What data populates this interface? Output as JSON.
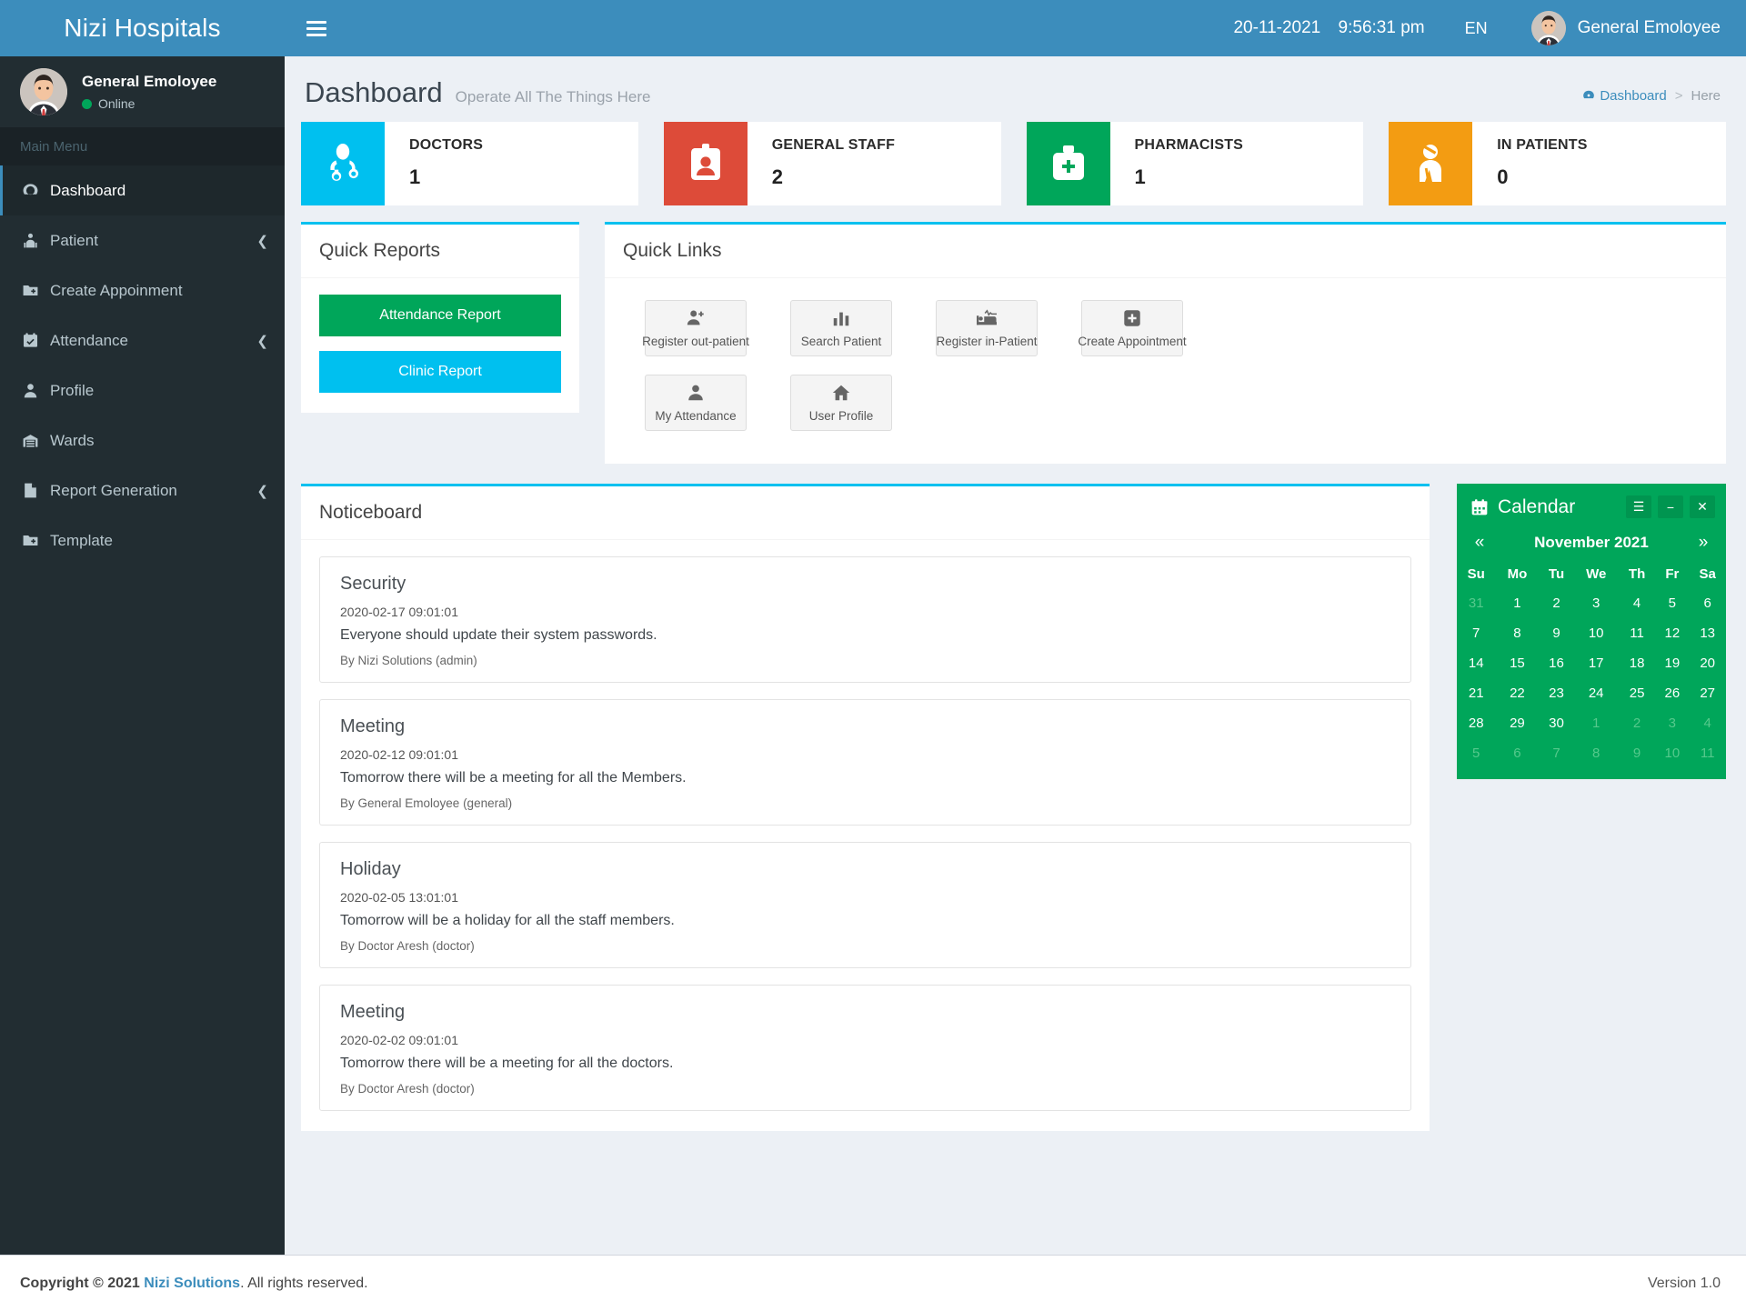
{
  "brand": {
    "title": "Nizi Hospitals"
  },
  "navbar": {
    "date": "20-11-2021",
    "time": "9:56:31 pm",
    "lang": "EN",
    "user": "General Emoloyee"
  },
  "sidebar": {
    "user": {
      "name": "General Emoloyee",
      "status": "Online"
    },
    "section_label": "Main Menu",
    "items": [
      {
        "label": "Dashboard",
        "icon": "dashboard-icon",
        "active": true,
        "caret": false
      },
      {
        "label": "Patient",
        "icon": "patient-icon",
        "active": false,
        "caret": true
      },
      {
        "label": "Create Appoinment",
        "icon": "folder-plus-icon",
        "active": false,
        "caret": false
      },
      {
        "label": "Attendance",
        "icon": "calendar-check-icon",
        "active": false,
        "caret": true
      },
      {
        "label": "Profile",
        "icon": "user-icon",
        "active": false,
        "caret": false
      },
      {
        "label": "Wards",
        "icon": "warehouse-icon",
        "active": false,
        "caret": false
      },
      {
        "label": "Report Generation",
        "icon": "file-icon",
        "active": false,
        "caret": true
      },
      {
        "label": "Template",
        "icon": "folder-plus-icon",
        "active": false,
        "caret": false
      }
    ]
  },
  "page": {
    "title": "Dashboard",
    "subtitle": "Operate All The Things Here",
    "breadcrumb": {
      "root": "Dashboard",
      "separator": ">",
      "current": "Here"
    }
  },
  "stats": [
    {
      "label": "DOCTORS",
      "value": "1",
      "color": "#00c0ef",
      "icon": "doctor-icon"
    },
    {
      "label": "GENERAL STAFF",
      "value": "2",
      "color": "#dd4b39",
      "icon": "id-badge-icon"
    },
    {
      "label": "PHARMACISTS",
      "value": "1",
      "color": "#00a65a",
      "icon": "medkit-icon"
    },
    {
      "label": "IN PATIENTS",
      "value": "0",
      "color": "#f39c12",
      "icon": "injured-icon"
    }
  ],
  "quick_reports": {
    "title": "Quick Reports",
    "buttons": [
      {
        "label": "Attendance Report",
        "color": "#00a65a"
      },
      {
        "label": "Clinic Report",
        "color": "#00c0ef"
      }
    ]
  },
  "quick_links": {
    "title": "Quick Links",
    "items": [
      {
        "label": "Register out-patient",
        "icon": "user-plus-icon"
      },
      {
        "label": "Search Patient",
        "icon": "chart-bar-icon"
      },
      {
        "label": "Register in-Patient",
        "icon": "bed-monitor-icon"
      },
      {
        "label": "Create Appointment",
        "icon": "plus-square-icon"
      },
      {
        "label": "My Attendance",
        "icon": "user-icon"
      },
      {
        "label": "User Profile",
        "icon": "home-icon"
      }
    ]
  },
  "noticeboard": {
    "title": "Noticeboard",
    "notices": [
      {
        "title": "Security",
        "date": "2020-02-17 09:01:01",
        "body": "Everyone should update their system passwords.",
        "author": "By Nizi Solutions (admin)"
      },
      {
        "title": "Meeting",
        "date": "2020-02-12 09:01:01",
        "body": "Tomorrow there will be a meeting for all the Members.",
        "author": "By General Emoloyee (general)"
      },
      {
        "title": "Holiday",
        "date": "2020-02-05 13:01:01",
        "body": "Tomorrow will be a holiday for all the staff members.",
        "author": "By Doctor Aresh (doctor)"
      },
      {
        "title": "Meeting",
        "date": "2020-02-02 09:01:01",
        "body": "Tomorrow there will be a meeting for all the doctors.",
        "author": "By Doctor Aresh (doctor)"
      }
    ]
  },
  "calendar": {
    "title": "Calendar",
    "month_label": "November 2021",
    "prev": "«",
    "next": "»",
    "tools": {
      "menu": "☰",
      "minimize": "−",
      "close": "✕"
    },
    "weekdays": [
      "Su",
      "Mo",
      "Tu",
      "We",
      "Th",
      "Fr",
      "Sa"
    ],
    "weeks": [
      [
        {
          "d": "31",
          "mute": true
        },
        {
          "d": "1"
        },
        {
          "d": "2"
        },
        {
          "d": "3"
        },
        {
          "d": "4"
        },
        {
          "d": "5"
        },
        {
          "d": "6"
        }
      ],
      [
        {
          "d": "7"
        },
        {
          "d": "8"
        },
        {
          "d": "9"
        },
        {
          "d": "10"
        },
        {
          "d": "11"
        },
        {
          "d": "12"
        },
        {
          "d": "13"
        }
      ],
      [
        {
          "d": "14"
        },
        {
          "d": "15"
        },
        {
          "d": "16"
        },
        {
          "d": "17"
        },
        {
          "d": "18"
        },
        {
          "d": "19"
        },
        {
          "d": "20"
        }
      ],
      [
        {
          "d": "21"
        },
        {
          "d": "22"
        },
        {
          "d": "23"
        },
        {
          "d": "24"
        },
        {
          "d": "25"
        },
        {
          "d": "26"
        },
        {
          "d": "27"
        }
      ],
      [
        {
          "d": "28"
        },
        {
          "d": "29"
        },
        {
          "d": "30"
        },
        {
          "d": "1",
          "mute": true
        },
        {
          "d": "2",
          "mute": true
        },
        {
          "d": "3",
          "mute": true
        },
        {
          "d": "4",
          "mute": true
        }
      ],
      [
        {
          "d": "5",
          "mute": true
        },
        {
          "d": "6",
          "mute": true
        },
        {
          "d": "7",
          "mute": true
        },
        {
          "d": "8",
          "mute": true
        },
        {
          "d": "9",
          "mute": true
        },
        {
          "d": "10",
          "mute": true
        },
        {
          "d": "11",
          "mute": true
        }
      ]
    ]
  },
  "footer": {
    "copyright_prefix": "Copyright © 2021",
    "company": "Nizi Solutions",
    "rights": ". All rights reserved.",
    "version": "Version 1.0"
  }
}
